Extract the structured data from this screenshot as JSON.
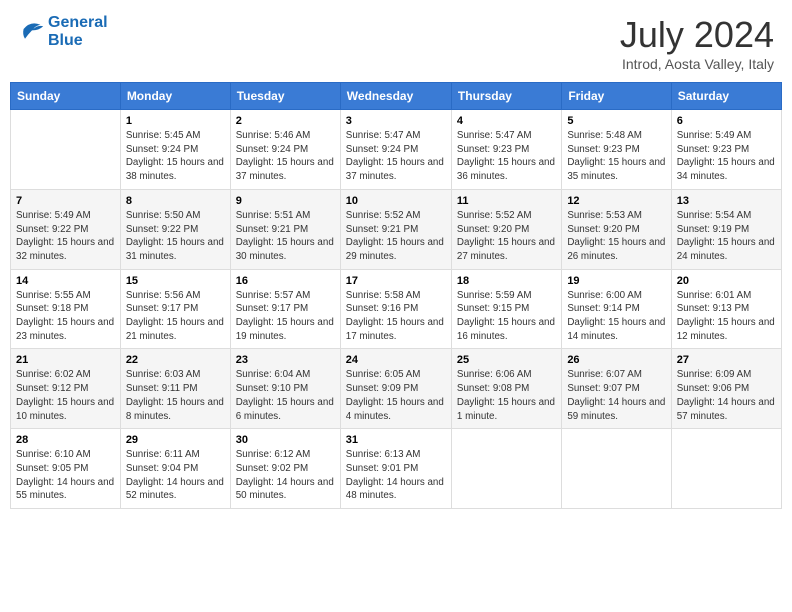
{
  "header": {
    "logo_line1": "General",
    "logo_line2": "Blue",
    "month": "July 2024",
    "location": "Introd, Aosta Valley, Italy"
  },
  "weekdays": [
    "Sunday",
    "Monday",
    "Tuesday",
    "Wednesday",
    "Thursday",
    "Friday",
    "Saturday"
  ],
  "weeks": [
    [
      {
        "day": "",
        "sunrise": "",
        "sunset": "",
        "daylight": ""
      },
      {
        "day": "1",
        "sunrise": "Sunrise: 5:45 AM",
        "sunset": "Sunset: 9:24 PM",
        "daylight": "Daylight: 15 hours and 38 minutes."
      },
      {
        "day": "2",
        "sunrise": "Sunrise: 5:46 AM",
        "sunset": "Sunset: 9:24 PM",
        "daylight": "Daylight: 15 hours and 37 minutes."
      },
      {
        "day": "3",
        "sunrise": "Sunrise: 5:47 AM",
        "sunset": "Sunset: 9:24 PM",
        "daylight": "Daylight: 15 hours and 37 minutes."
      },
      {
        "day": "4",
        "sunrise": "Sunrise: 5:47 AM",
        "sunset": "Sunset: 9:23 PM",
        "daylight": "Daylight: 15 hours and 36 minutes."
      },
      {
        "day": "5",
        "sunrise": "Sunrise: 5:48 AM",
        "sunset": "Sunset: 9:23 PM",
        "daylight": "Daylight: 15 hours and 35 minutes."
      },
      {
        "day": "6",
        "sunrise": "Sunrise: 5:49 AM",
        "sunset": "Sunset: 9:23 PM",
        "daylight": "Daylight: 15 hours and 34 minutes."
      }
    ],
    [
      {
        "day": "7",
        "sunrise": "Sunrise: 5:49 AM",
        "sunset": "Sunset: 9:22 PM",
        "daylight": "Daylight: 15 hours and 32 minutes."
      },
      {
        "day": "8",
        "sunrise": "Sunrise: 5:50 AM",
        "sunset": "Sunset: 9:22 PM",
        "daylight": "Daylight: 15 hours and 31 minutes."
      },
      {
        "day": "9",
        "sunrise": "Sunrise: 5:51 AM",
        "sunset": "Sunset: 9:21 PM",
        "daylight": "Daylight: 15 hours and 30 minutes."
      },
      {
        "day": "10",
        "sunrise": "Sunrise: 5:52 AM",
        "sunset": "Sunset: 9:21 PM",
        "daylight": "Daylight: 15 hours and 29 minutes."
      },
      {
        "day": "11",
        "sunrise": "Sunrise: 5:52 AM",
        "sunset": "Sunset: 9:20 PM",
        "daylight": "Daylight: 15 hours and 27 minutes."
      },
      {
        "day": "12",
        "sunrise": "Sunrise: 5:53 AM",
        "sunset": "Sunset: 9:20 PM",
        "daylight": "Daylight: 15 hours and 26 minutes."
      },
      {
        "day": "13",
        "sunrise": "Sunrise: 5:54 AM",
        "sunset": "Sunset: 9:19 PM",
        "daylight": "Daylight: 15 hours and 24 minutes."
      }
    ],
    [
      {
        "day": "14",
        "sunrise": "Sunrise: 5:55 AM",
        "sunset": "Sunset: 9:18 PM",
        "daylight": "Daylight: 15 hours and 23 minutes."
      },
      {
        "day": "15",
        "sunrise": "Sunrise: 5:56 AM",
        "sunset": "Sunset: 9:17 PM",
        "daylight": "Daylight: 15 hours and 21 minutes."
      },
      {
        "day": "16",
        "sunrise": "Sunrise: 5:57 AM",
        "sunset": "Sunset: 9:17 PM",
        "daylight": "Daylight: 15 hours and 19 minutes."
      },
      {
        "day": "17",
        "sunrise": "Sunrise: 5:58 AM",
        "sunset": "Sunset: 9:16 PM",
        "daylight": "Daylight: 15 hours and 17 minutes."
      },
      {
        "day": "18",
        "sunrise": "Sunrise: 5:59 AM",
        "sunset": "Sunset: 9:15 PM",
        "daylight": "Daylight: 15 hours and 16 minutes."
      },
      {
        "day": "19",
        "sunrise": "Sunrise: 6:00 AM",
        "sunset": "Sunset: 9:14 PM",
        "daylight": "Daylight: 15 hours and 14 minutes."
      },
      {
        "day": "20",
        "sunrise": "Sunrise: 6:01 AM",
        "sunset": "Sunset: 9:13 PM",
        "daylight": "Daylight: 15 hours and 12 minutes."
      }
    ],
    [
      {
        "day": "21",
        "sunrise": "Sunrise: 6:02 AM",
        "sunset": "Sunset: 9:12 PM",
        "daylight": "Daylight: 15 hours and 10 minutes."
      },
      {
        "day": "22",
        "sunrise": "Sunrise: 6:03 AM",
        "sunset": "Sunset: 9:11 PM",
        "daylight": "Daylight: 15 hours and 8 minutes."
      },
      {
        "day": "23",
        "sunrise": "Sunrise: 6:04 AM",
        "sunset": "Sunset: 9:10 PM",
        "daylight": "Daylight: 15 hours and 6 minutes."
      },
      {
        "day": "24",
        "sunrise": "Sunrise: 6:05 AM",
        "sunset": "Sunset: 9:09 PM",
        "daylight": "Daylight: 15 hours and 4 minutes."
      },
      {
        "day": "25",
        "sunrise": "Sunrise: 6:06 AM",
        "sunset": "Sunset: 9:08 PM",
        "daylight": "Daylight: 15 hours and 1 minute."
      },
      {
        "day": "26",
        "sunrise": "Sunrise: 6:07 AM",
        "sunset": "Sunset: 9:07 PM",
        "daylight": "Daylight: 14 hours and 59 minutes."
      },
      {
        "day": "27",
        "sunrise": "Sunrise: 6:09 AM",
        "sunset": "Sunset: 9:06 PM",
        "daylight": "Daylight: 14 hours and 57 minutes."
      }
    ],
    [
      {
        "day": "28",
        "sunrise": "Sunrise: 6:10 AM",
        "sunset": "Sunset: 9:05 PM",
        "daylight": "Daylight: 14 hours and 55 minutes."
      },
      {
        "day": "29",
        "sunrise": "Sunrise: 6:11 AM",
        "sunset": "Sunset: 9:04 PM",
        "daylight": "Daylight: 14 hours and 52 minutes."
      },
      {
        "day": "30",
        "sunrise": "Sunrise: 6:12 AM",
        "sunset": "Sunset: 9:02 PM",
        "daylight": "Daylight: 14 hours and 50 minutes."
      },
      {
        "day": "31",
        "sunrise": "Sunrise: 6:13 AM",
        "sunset": "Sunset: 9:01 PM",
        "daylight": "Daylight: 14 hours and 48 minutes."
      },
      {
        "day": "",
        "sunrise": "",
        "sunset": "",
        "daylight": ""
      },
      {
        "day": "",
        "sunrise": "",
        "sunset": "",
        "daylight": ""
      },
      {
        "day": "",
        "sunrise": "",
        "sunset": "",
        "daylight": ""
      }
    ]
  ]
}
